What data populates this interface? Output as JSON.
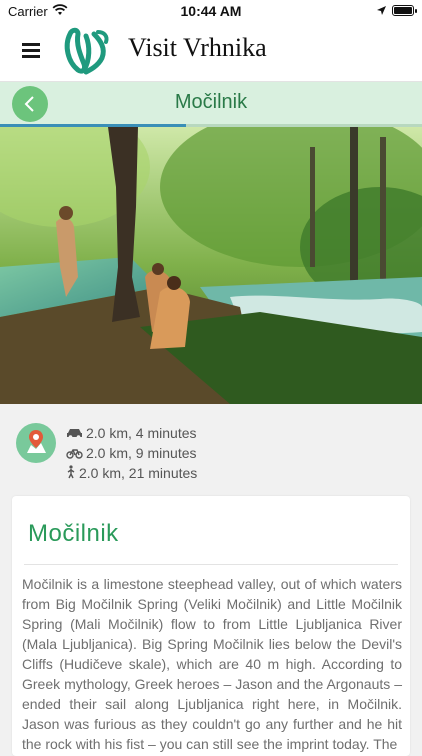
{
  "status_bar": {
    "carrier": "Carrier",
    "time": "10:44 AM"
  },
  "header": {
    "title": "Visit Vrhnika",
    "logo": "vrhnika-logo"
  },
  "title_bar": {
    "title": "Močilnik",
    "progress": 0.44
  },
  "hero_photo": {
    "alt": "forest-spring-photo"
  },
  "travel": {
    "car": "2.0 km, 4 minutes",
    "bike": "2.0 km, 9 minutes",
    "walk": "2.0 km, 21 minutes"
  },
  "card": {
    "title": "Močilnik",
    "body": "Močilnik is a limestone steephead valley, out of which waters from Big Močilnik Spring (Veliki Močilnik) and Little Močilnik Spring (Mali Močilnik) flow to from Little Ljubljanica River (Mala Ljubljanica). Big Spring Močilnik lies below the Devil's Cliffs (Hudičeve skale), which are 40 m high. According to Greek mythology, Greek heroes – Jason and the Argonauts – ended their sail along Ljubljanica right here, in Močilnik. Jason was furious as they couldn't go any further and he hit the rock with his fist – you can still see the imprint today. The"
  },
  "colors": {
    "accent": "#2a9a5a",
    "title_bar_bg": "#d9f0df",
    "back_button": "#6cc47c"
  }
}
